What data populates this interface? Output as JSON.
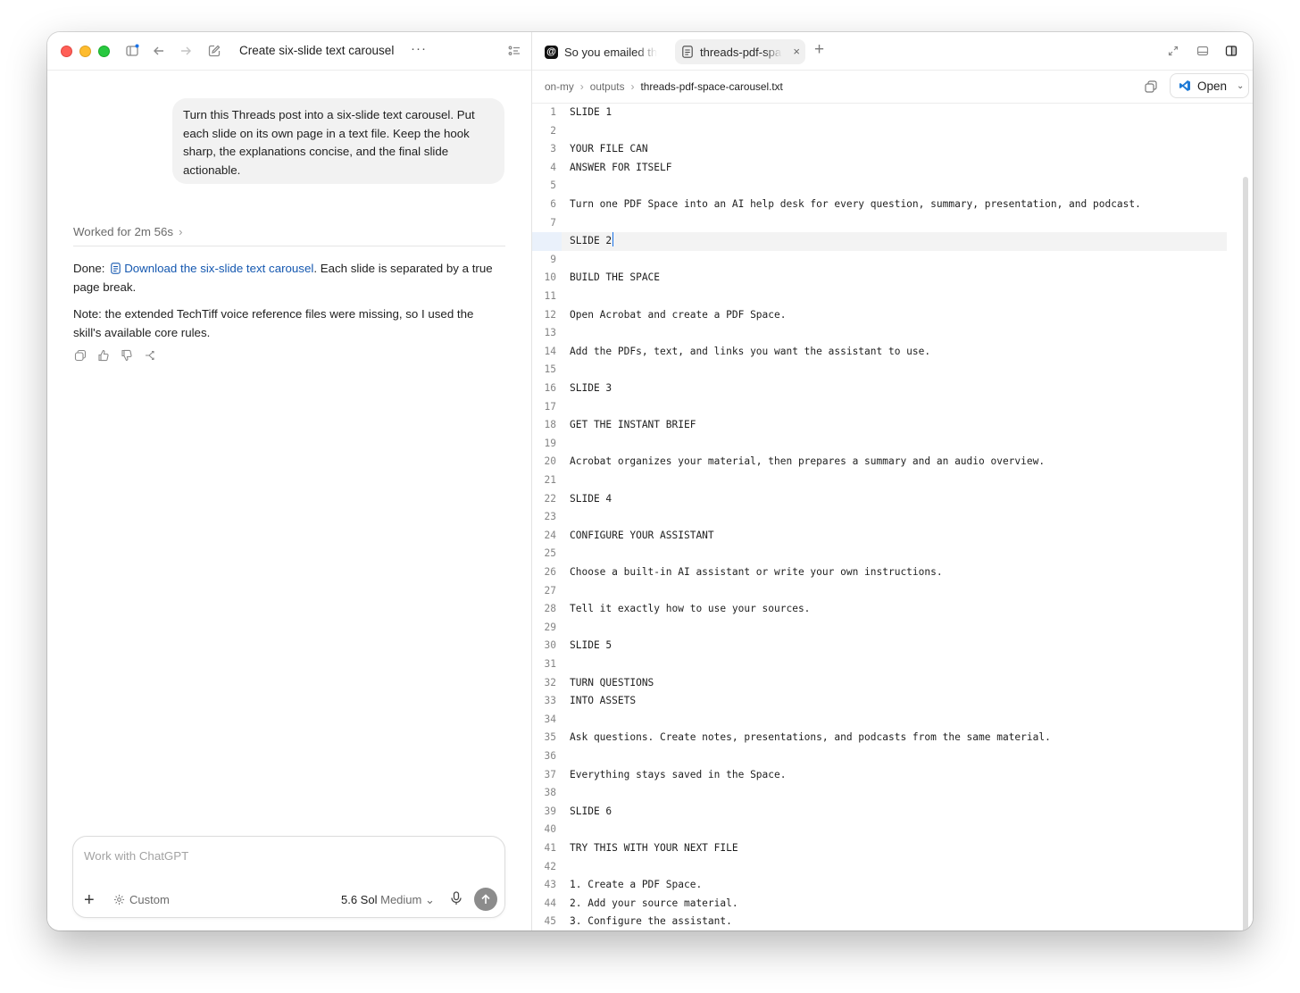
{
  "conversation": {
    "title": "Create six-slide text carousel",
    "more_label": "···",
    "user_message": "Turn this Threads post into a six-slide text carousel. Put each slide on its own page in a text file. Keep the hook sharp, the explanations concise, and the final slide actionable.",
    "worked_label": "Worked for 2m 56s",
    "done_prefix": "Done:",
    "download_link": "Download the six-slide text carousel",
    "done_suffix": ". Each slide is separated by a true page break.",
    "note": "Note: the extended TechTiff voice reference files were missing, so I used the skill's available core rules."
  },
  "composer": {
    "placeholder": "Work with ChatGPT",
    "plus_label": "+",
    "custom_label": "Custom",
    "model_name": "5.6 Sol",
    "model_effort": "Medium"
  },
  "tabs": [
    {
      "label": "So you emailed th"
    },
    {
      "label": "threads-pdf-space-carousel.txt",
      "close": "×"
    }
  ],
  "new_tab_label": "+",
  "breadcrumb": {
    "items": [
      "on-my",
      "outputs"
    ],
    "current": "threads-pdf-space-carousel.txt"
  },
  "open_button": {
    "label": "Open"
  },
  "editor": {
    "active_line": 8,
    "lines": [
      "SLIDE 1",
      "",
      "YOUR FILE CAN",
      "ANSWER FOR ITSELF",
      "",
      "Turn one PDF Space into an AI help desk for every question, summary, presentation, and podcast.",
      "",
      "SLIDE 2",
      "",
      "BUILD THE SPACE",
      "",
      "Open Acrobat and create a PDF Space.",
      "",
      "Add the PDFs, text, and links you want the assistant to use.",
      "",
      "SLIDE 3",
      "",
      "GET THE INSTANT BRIEF",
      "",
      "Acrobat organizes your material, then prepares a summary and an audio overview.",
      "",
      "SLIDE 4",
      "",
      "CONFIGURE YOUR ASSISTANT",
      "",
      "Choose a built-in AI assistant or write your own instructions.",
      "",
      "Tell it exactly how to use your sources.",
      "",
      "SLIDE 5",
      "",
      "TURN QUESTIONS",
      "INTO ASSETS",
      "",
      "Ask questions. Create notes, presentations, and podcasts from the same material.",
      "",
      "Everything stays saved in the Space.",
      "",
      "SLIDE 6",
      "",
      "TRY THIS WITH YOUR NEXT FILE",
      "",
      "1. Create a PDF Space.",
      "2. Add your source material.",
      "3. Configure the assistant."
    ]
  },
  "colors": {
    "accent_link": "#1558b0",
    "caret": "#1a73e8",
    "traffic_red": "#ff5f57",
    "traffic_yellow": "#febc2e",
    "traffic_green": "#28c840",
    "send_button": "#8c8c8c"
  }
}
